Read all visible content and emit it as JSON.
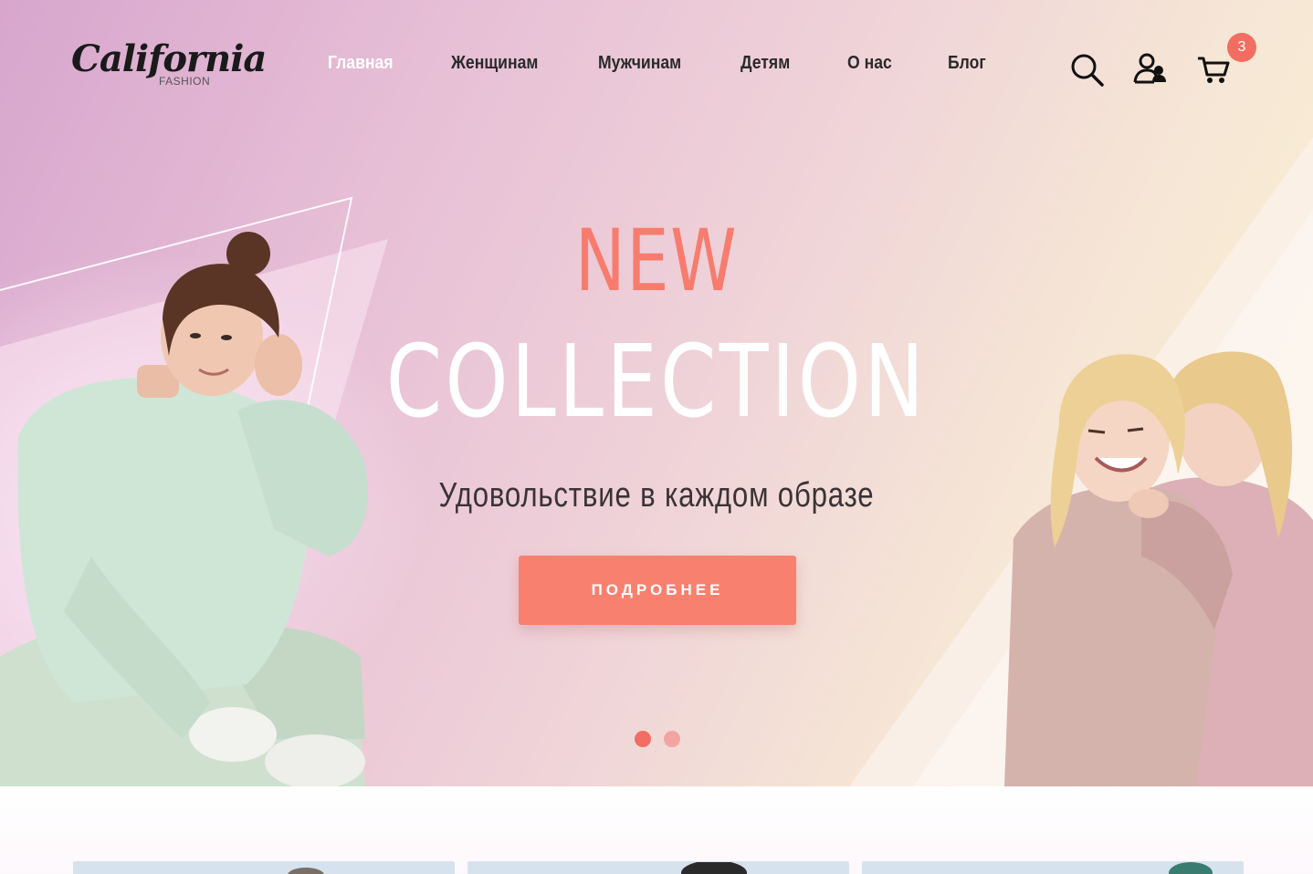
{
  "brand": {
    "name": "California",
    "sub": "FASHION"
  },
  "nav": {
    "items": [
      {
        "label": "Главная",
        "active": true
      },
      {
        "label": "Женщинам"
      },
      {
        "label": "Мужчинам"
      },
      {
        "label": "Детям"
      },
      {
        "label": "О нас"
      },
      {
        "label": "Блог"
      }
    ]
  },
  "header_icons": {
    "search": "search-icon",
    "account": "user-icon",
    "cart": "cart-icon",
    "cart_count": "3"
  },
  "hero": {
    "headline_1": "NEW",
    "headline_2": "COLLECTION",
    "tagline": "Удовольствие в каждом образе",
    "cta_label": "ПОДРОБНЕЕ",
    "slides": 2,
    "active_slide": 1
  },
  "colors": {
    "accent": "#f8806f",
    "accent_text": "#f77c6e",
    "nav_active": "#ffffff",
    "text_dark": "#2a2a2a"
  }
}
